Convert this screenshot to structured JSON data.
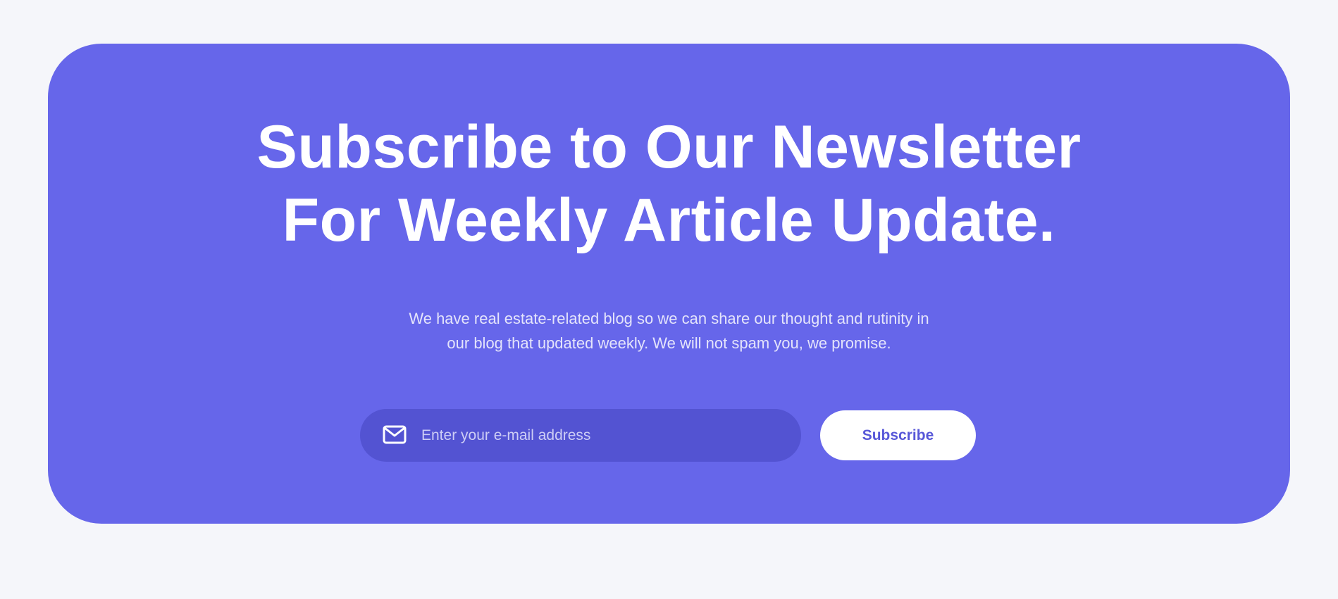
{
  "newsletter": {
    "headline_line1": "Subscribe to Our Newsletter",
    "headline_line2": "For Weekly Article Update.",
    "description_line1": "We have real estate-related blog so we can share our thought and rutinity in",
    "description_line2": "our blog that updated weekly. We will not spam you, we promise.",
    "email_placeholder": "Enter your e-mail address",
    "email_value": "",
    "email_icon": "mail-icon",
    "subscribe_label": "Subscribe"
  },
  "colors": {
    "page_background": "#f5f6fa",
    "card_background": "#6666ea",
    "input_background": "#5353d2",
    "button_background": "#ffffff",
    "button_text": "#5757d8"
  }
}
